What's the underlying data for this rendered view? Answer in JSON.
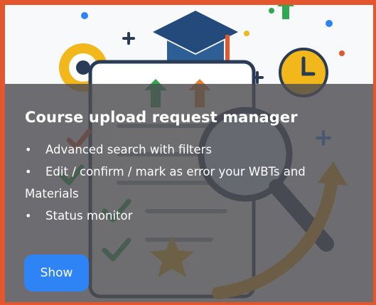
{
  "card": {
    "title": "Course upload request manager",
    "features": [
      "Advanced search with filters",
      "Edit / confirm / mark as error your WBTs and Materials",
      "Status monitor"
    ],
    "bullet": "•",
    "button_label": "Show"
  },
  "colors": {
    "frame_border": "#e4572e",
    "overlay": "rgba(78,78,82,0.82)",
    "button": "#2f84f5",
    "text": "#ffffff"
  },
  "icons": [
    "gear-icon",
    "graduation-cap-icon",
    "clock-icon",
    "magnifier-icon",
    "checkmark-icon",
    "star-icon",
    "arrow-up-icon",
    "clipboard-icon"
  ]
}
